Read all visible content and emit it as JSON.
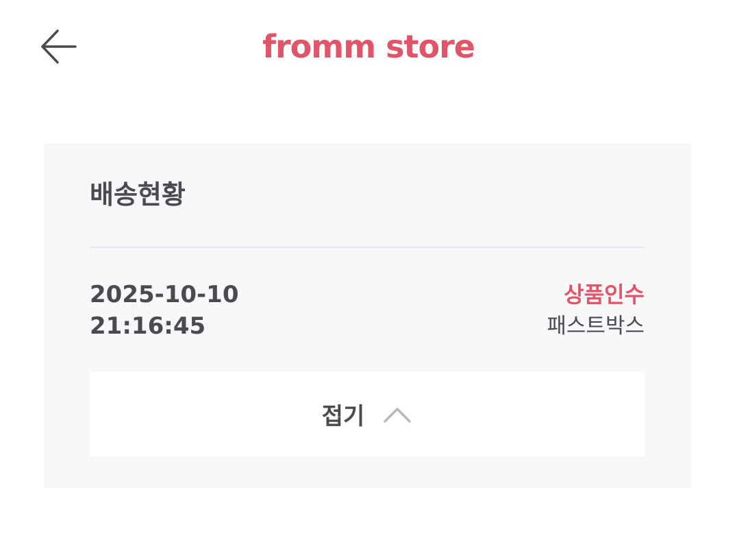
{
  "header": {
    "brand": "fromm store",
    "back_icon": "arrow-left-icon"
  },
  "delivery": {
    "title": "배송현황",
    "date": "2025-10-10",
    "time": "21:16:45",
    "status": "상품인수",
    "courier": "패스트박스",
    "collapse_label": "접기",
    "collapse_icon": "chevron-up-icon"
  },
  "colors": {
    "brand": "#e05568",
    "status": "#e05568",
    "text": "#4a4a4f",
    "panel_bg": "#f8f8fa",
    "chevron": "#b8b8bc"
  }
}
